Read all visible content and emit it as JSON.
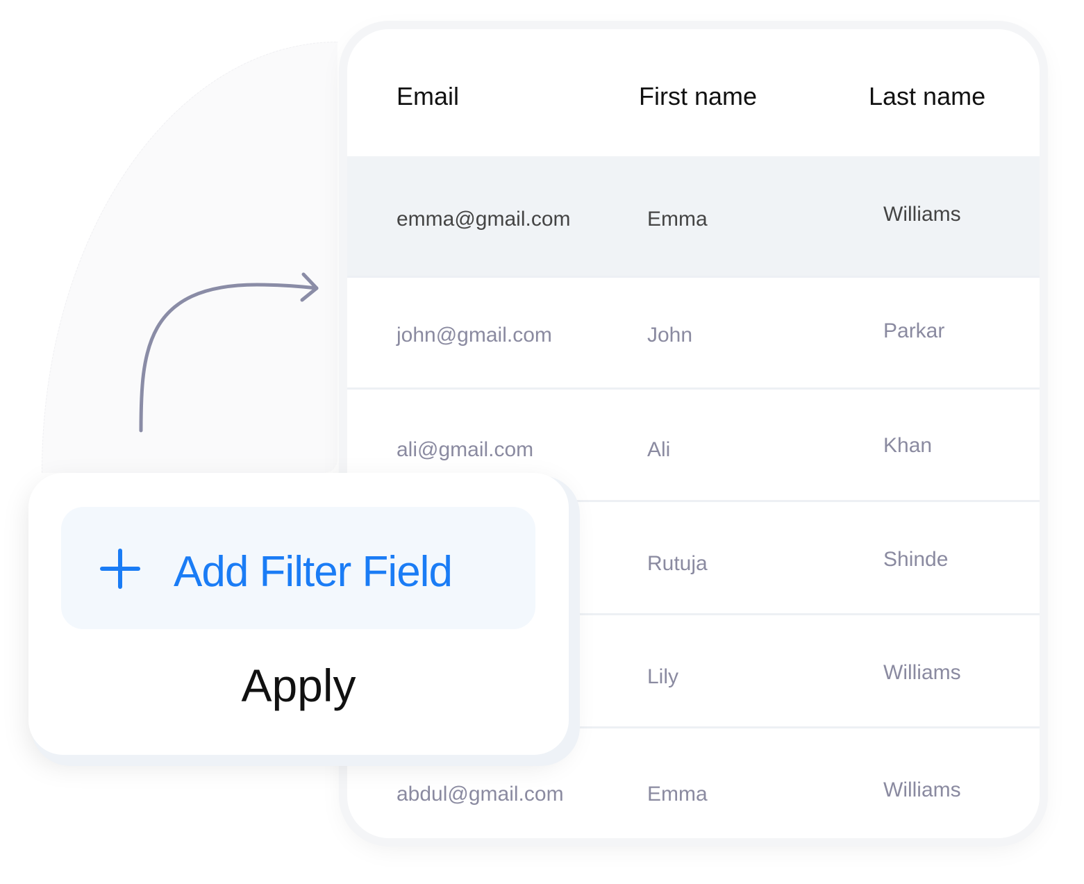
{
  "table": {
    "columns": [
      "Email",
      "First name",
      "Last name"
    ],
    "rows": [
      {
        "email": "emma@gmail.com",
        "first": "Emma",
        "last": "Williams",
        "highlighted": true
      },
      {
        "email": "john@gmail.com",
        "first": "John",
        "last": "Parkar"
      },
      {
        "email": "ali@gmail.com",
        "first": "Ali",
        "last": "Khan"
      },
      {
        "email": "",
        "first": "Rutuja",
        "last": "Shinde"
      },
      {
        "email": "",
        "first": "Lily",
        "last": "Williams"
      },
      {
        "email": "abdul@gmail.com",
        "first": "Emma",
        "last": "Williams"
      }
    ],
    "highlight_color": "#f0f3f6"
  },
  "filter_popup": {
    "add_filter_label": "Add Filter Field",
    "add_icon": "plus-icon",
    "apply_label": "Apply",
    "accent_color": "#1a7cf5"
  },
  "decor": {
    "arrow_icon": "curved-arrow-icon"
  }
}
